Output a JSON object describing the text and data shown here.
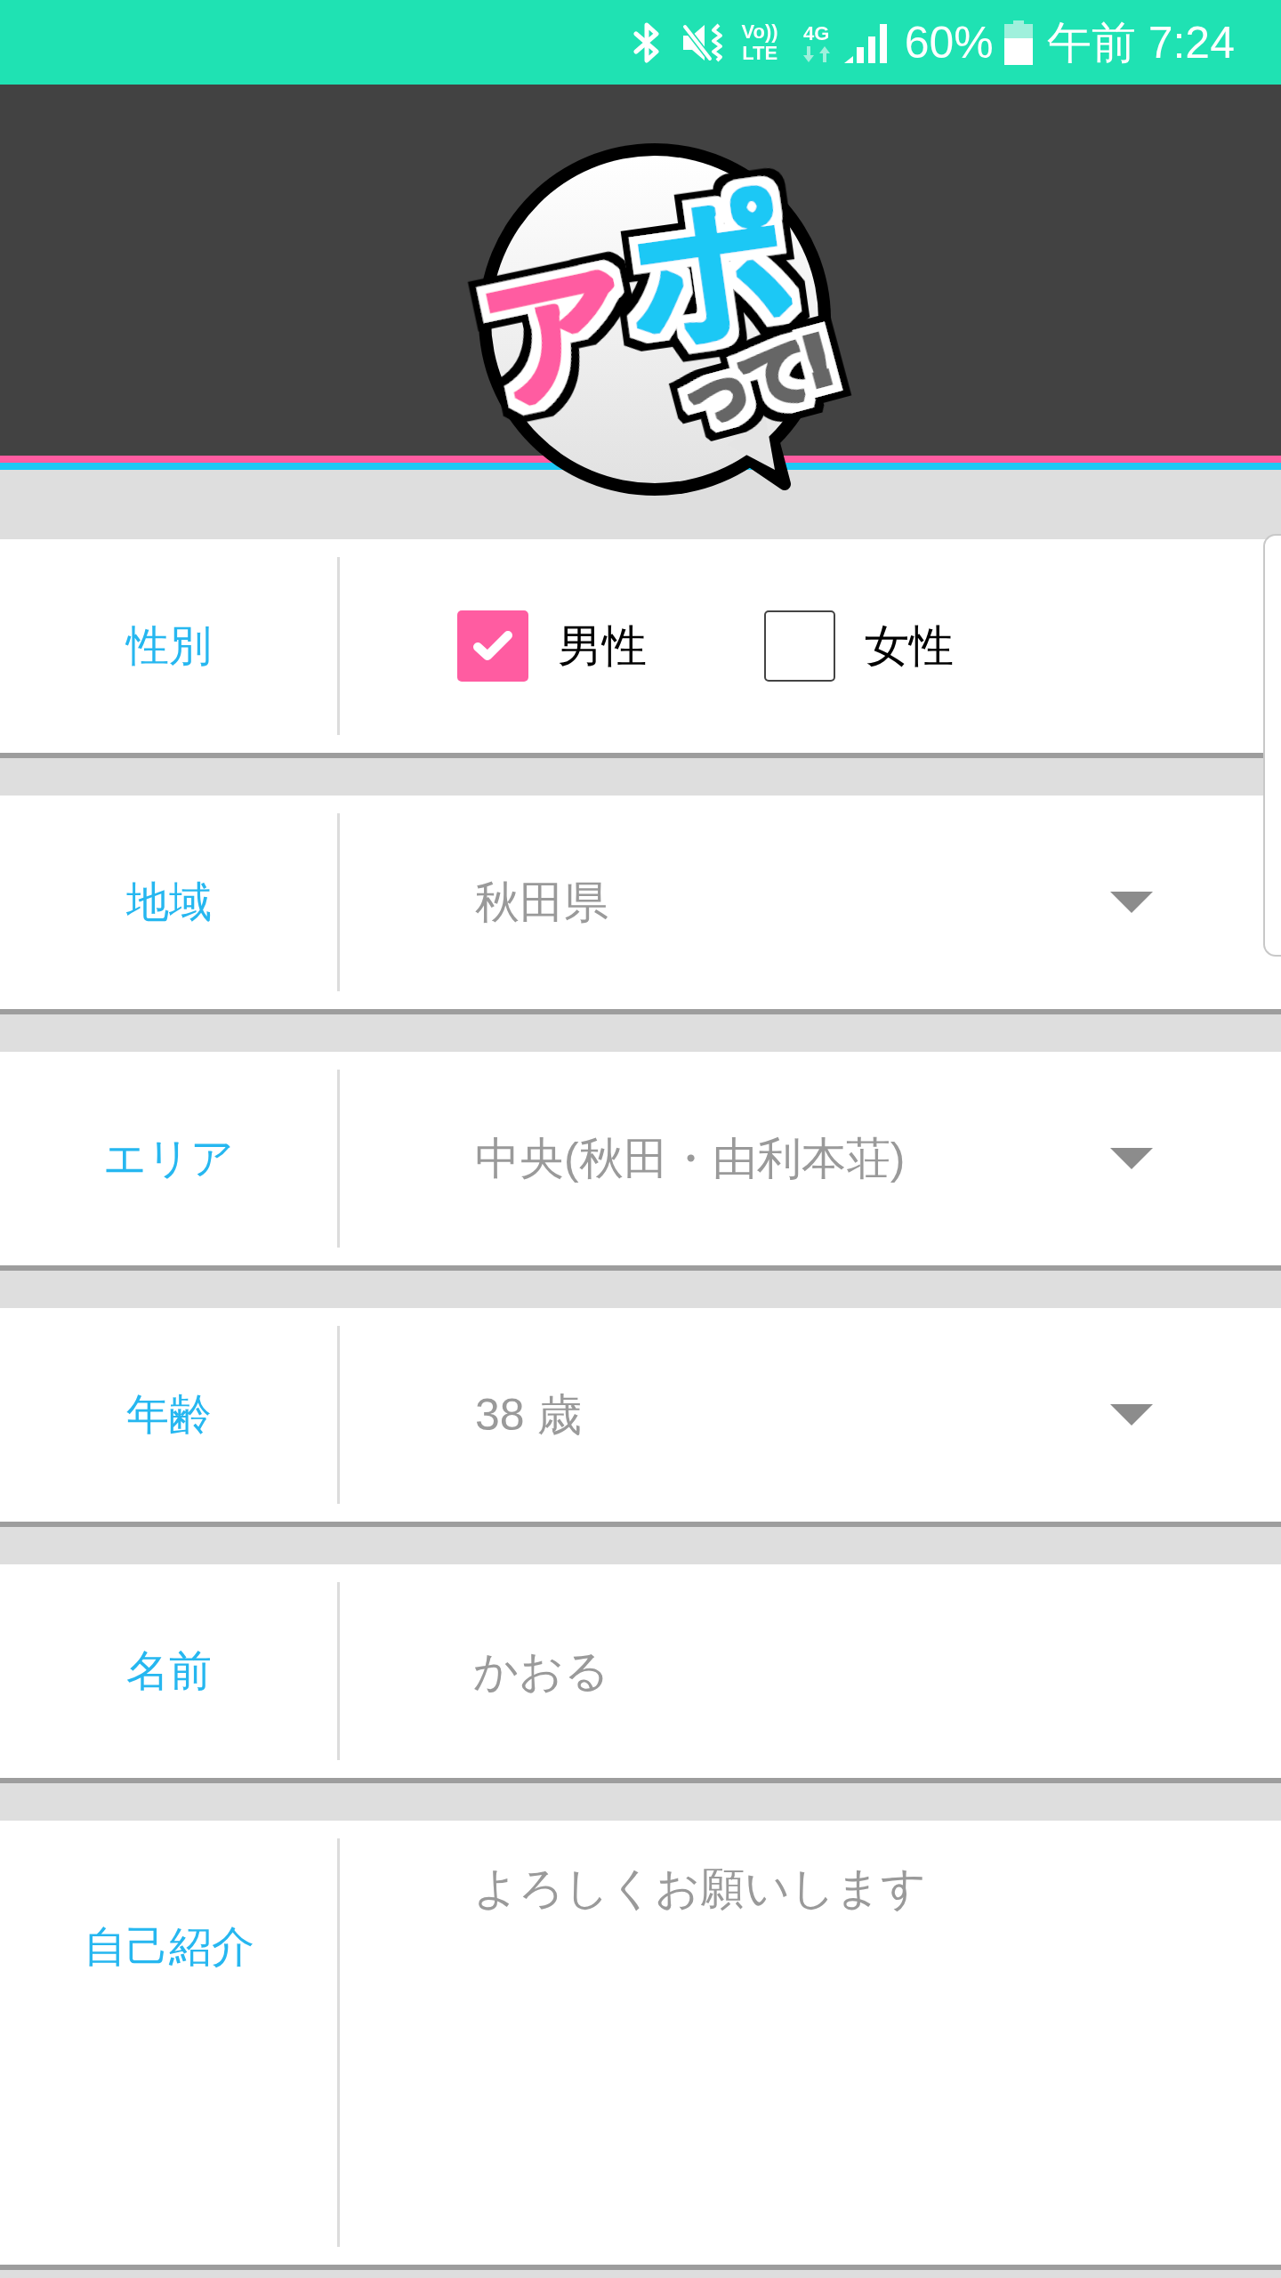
{
  "status_bar": {
    "volte": {
      "top": "Vo))",
      "bottom": "LTE"
    },
    "network": "4G",
    "battery": "60%",
    "time": "午前 7:24"
  },
  "header": {
    "logo": [
      {
        "text": "ア",
        "color": "#ff5ca1"
      },
      {
        "text": "ポ",
        "color": "#1ec8f5"
      },
      {
        "text": "って!",
        "color": "#666666"
      }
    ]
  },
  "form": {
    "rows": [
      {
        "kind": "checkbox",
        "label": "性別",
        "options": [
          {
            "label": "男性",
            "checked": true
          },
          {
            "label": "女性",
            "checked": false
          }
        ]
      },
      {
        "kind": "select",
        "label": "地域",
        "value": "秋田県"
      },
      {
        "kind": "select",
        "label": "エリア",
        "value": "中央(秋田・由利本荘)"
      },
      {
        "kind": "select",
        "label": "年齢",
        "value": "38 歳"
      },
      {
        "kind": "text",
        "label": "名前",
        "value": "かおる"
      },
      {
        "kind": "textarea",
        "label": "自己紹介",
        "value": "よろしくお願いします"
      }
    ]
  }
}
